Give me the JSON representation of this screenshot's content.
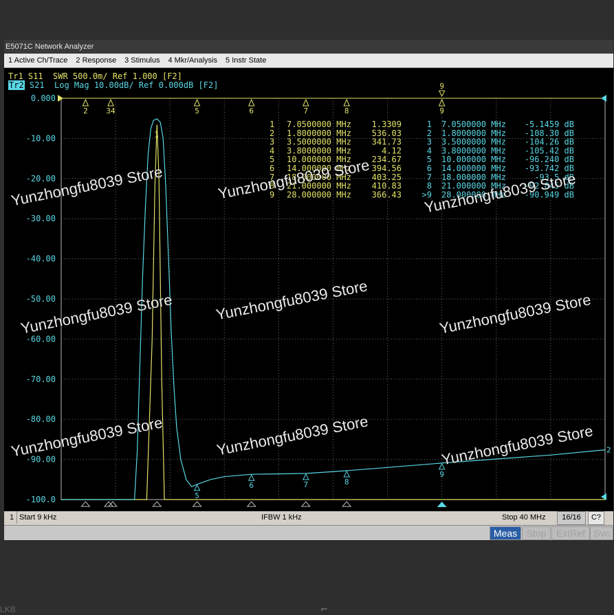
{
  "window": {
    "title": "E5071C Network Analyzer"
  },
  "menu": [
    "1 Active Ch/Trace",
    "2 Response",
    "3 Stimulus",
    "4 Mkr/Analysis",
    "5 Instr State"
  ],
  "traces": {
    "tr1_label": "Tr1",
    "tr1_info": " S11  SWR 500.0m/ Ref 1.000 [F2]",
    "tr2_label": "Tr2",
    "tr2_info": " S21  Log Mag 10.00dB/ Ref 0.000dB [F2]",
    "tr1_color": "#e3e36a",
    "tr2_color": "#59d7e5"
  },
  "y_axis": {
    "labels": [
      "0.000",
      "-10.00",
      "-20.00",
      "-30.00",
      "-40.00",
      "-50.00",
      "-60.00",
      "-70.00",
      "-80.00",
      "-90.00",
      "-100.0"
    ],
    "min": -100,
    "max": 0
  },
  "x_axis": {
    "start_mhz": 0.009,
    "stop_mhz": 40
  },
  "markers_tr1": [
    {
      "id": "1",
      "freq": "7.0500000 MHz",
      "value": "1.3309"
    },
    {
      "id": "2",
      "freq": "1.8000000 MHz",
      "value": "536.03"
    },
    {
      "id": "3",
      "freq": "3.5000000 MHz",
      "value": "341.73"
    },
    {
      "id": "4",
      "freq": "3.8000000 MHz",
      "value": "4.12"
    },
    {
      "id": "5",
      "freq": "10.000000 MHz",
      "value": "234.67"
    },
    {
      "id": "6",
      "freq": "14.000000 MHz",
      "value": "394.56"
    },
    {
      "id": "7",
      "freq": "18.000000 MHz",
      "value": "403.25"
    },
    {
      "id": "8",
      "freq": "21.000000 MHz",
      "value": "410.83"
    },
    {
      "id": "9",
      "freq": "28.000000 MHz",
      "value": "366.43"
    }
  ],
  "markers_tr2": [
    {
      "id": "1",
      "freq": "7.0500000 MHz",
      "value": "-5.1459 dB"
    },
    {
      "id": "2",
      "freq": "1.8000000 MHz",
      "value": "-108.30 dB"
    },
    {
      "id": "3",
      "freq": "3.5000000 MHz",
      "value": "-104.26 dB"
    },
    {
      "id": "4",
      "freq": "3.8000000 MHz",
      "value": "-105.42 dB"
    },
    {
      "id": "5",
      "freq": "10.000000 MHz",
      "value": "-96.240 dB"
    },
    {
      "id": "6",
      "freq": "14.000000 MHz",
      "value": "-93.742 dB"
    },
    {
      "id": "7",
      "freq": "18.000000 MHz",
      "value": "-93.5 dB"
    },
    {
      "id": "8",
      "freq": "21.000000 MHz",
      "value": "-92.845 dB"
    },
    {
      "id": ">9",
      "freq": "28.000000 MHz",
      "value": "-90.949 dB"
    }
  ],
  "marker_positions": [
    {
      "id": "2",
      "mhz": 1.8
    },
    {
      "id": "3",
      "mhz": 3.5
    },
    {
      "id": "4",
      "mhz": 3.8
    },
    {
      "id": "5",
      "mhz": 10.0
    },
    {
      "id": "6",
      "mhz": 14.0
    },
    {
      "id": "7",
      "mhz": 18.0
    },
    {
      "id": "8",
      "mhz": 21.0
    },
    {
      "id": "9",
      "mhz": 28.0
    }
  ],
  "top_marker_labels": [
    "2",
    "34",
    "5",
    "6",
    "7",
    "8",
    "9"
  ],
  "trace_marker_labels": [
    "1",
    "5",
    "6",
    "7",
    "8",
    "9",
    "2"
  ],
  "s21_trace_db": [
    [
      0.009,
      -100
    ],
    [
      5.4,
      -100
    ],
    [
      5.6,
      -88
    ],
    [
      5.8,
      -66
    ],
    [
      6.0,
      -44
    ],
    [
      6.2,
      -27
    ],
    [
      6.4,
      -14
    ],
    [
      6.6,
      -7.5
    ],
    [
      6.8,
      -5.5
    ],
    [
      7.05,
      -5.1
    ],
    [
      7.3,
      -6.0
    ],
    [
      7.5,
      -10
    ],
    [
      7.7,
      -22
    ],
    [
      7.9,
      -40
    ],
    [
      8.1,
      -58
    ],
    [
      8.3,
      -72
    ],
    [
      8.5,
      -82
    ],
    [
      8.8,
      -90
    ],
    [
      9.2,
      -95
    ],
    [
      9.6,
      -96.8
    ],
    [
      10.0,
      -96.2
    ],
    [
      11.0,
      -95.0
    ],
    [
      12.0,
      -94.3
    ],
    [
      14.0,
      -93.7
    ],
    [
      18.0,
      -93.5
    ],
    [
      21.0,
      -92.8
    ],
    [
      24.0,
      -92.0
    ],
    [
      28.0,
      -90.9
    ],
    [
      32.0,
      -89.9
    ],
    [
      36.0,
      -88.9
    ],
    [
      40.0,
      -87.6
    ]
  ],
  "s11_trace_swr": [
    [
      0.009,
      7.0
    ],
    [
      5.5,
      7.0
    ],
    [
      6.3,
      6.2
    ],
    [
      6.7,
      4.0
    ],
    [
      6.9,
      2.1
    ],
    [
      7.05,
      1.33
    ],
    [
      7.2,
      2.0
    ],
    [
      7.4,
      4.5
    ],
    [
      7.6,
      6.8
    ],
    [
      8.0,
      7.0
    ],
    [
      40.0,
      7.0
    ]
  ],
  "status": {
    "channel": "1",
    "start": "Start 9 kHz",
    "ifbw": "IFBW 1 kHz",
    "stop": "Stop 40 MHz",
    "count": "16/16",
    "cal": "C?"
  },
  "softkeys": {
    "meas": "Meas",
    "stop": "Stop",
    "extref": "ExtRef",
    "svc": "Svc"
  },
  "watermark": "Yunzhongfu8039 Store",
  "bottom": {
    "left_text": "LKB",
    "glyph": "⌐"
  }
}
